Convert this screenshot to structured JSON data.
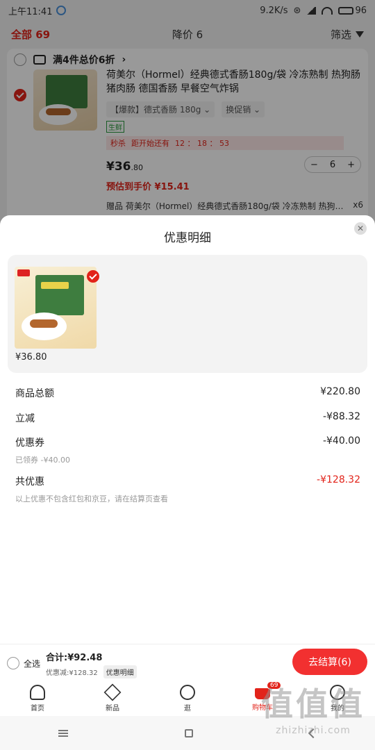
{
  "status_bar": {
    "time": "上午11:41",
    "net_speed": "9.2K/s",
    "battery": "96"
  },
  "filter_bar": {
    "all_label": "全部 69",
    "price_drop_label": "降价 6",
    "filter_label": "筛选"
  },
  "cart_item": {
    "promo_label": "满4件总价6折",
    "title": "荷美尔（Hormel）经典德式香肠180g/袋 冷冻熟制 热狗肠 猪肉肠 德国香肠 早餐空气炸锅",
    "spec": "【爆款】德式香肠 180g",
    "promo_switch": "换促销",
    "fresh_tag": "生鲜",
    "flash_label": "秒杀",
    "flash_countdown_label": "距开始还有",
    "flash_countdown": "12 ： 18 ： 53",
    "price_main": "¥36",
    "price_decimal": ".80",
    "quantity": "6",
    "estimated_price": "预估到手价 ¥15.41",
    "gift_text": "赠品 荷美尔（Hormel）经典德式香肠180g/袋 冷冻熟制 热狗…",
    "gift_qty": "x6"
  },
  "sheet": {
    "title": "优惠明细",
    "goods_price": "¥36.80",
    "rows": {
      "goods_total_label": "商品总额",
      "goods_total_value": "¥220.80",
      "instant_label": "立减",
      "instant_value": "-¥88.32",
      "coupon_label": "优惠券",
      "coupon_value": "-¥40.00",
      "coupon_note": "已领券 -¥40.00",
      "total_discount_label": "共优惠",
      "total_discount_value": "-¥128.32",
      "footnote": "以上优惠不包含红包和京豆，请在结算页查看"
    }
  },
  "checkout": {
    "select_all": "全选",
    "total": "合计:¥92.48",
    "discount": "优惠减:¥128.32",
    "detail_btn": "优惠明细",
    "checkout_btn": "去结算(6)"
  },
  "tabs": [
    {
      "label": "首页"
    },
    {
      "label": "新品"
    },
    {
      "label": "逛"
    },
    {
      "label": "购物车",
      "badge": "69"
    },
    {
      "label": "我的"
    }
  ],
  "watermark": {
    "top": "值值值",
    "bottom": "zhizhizhi.com"
  },
  "colors": {
    "accent_red": "#e2231a",
    "checkout_red": "#f23030"
  }
}
